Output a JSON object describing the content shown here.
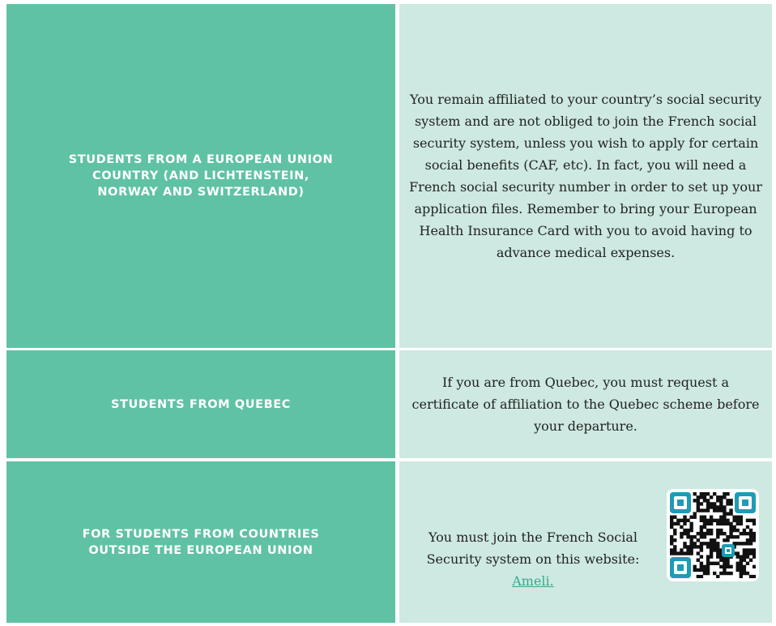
{
  "rows": [
    {
      "label": "STUDENTS FROM A EUROPEAN UNION COUNTRY (AND LICHTENSTEIN, NORWAY AND SWITZERLAND)",
      "text": "You remain affiliated to your country’s social security system and are not obliged to join the French social security system, unless you wish to apply for certain social benefits (CAF, etc). In fact, you will need a French social security number in order to set up your application files. Remember to bring your European Health Insurance Card with you to avoid having to advance medical expenses."
    },
    {
      "label": "STUDENTS FROM QUEBEC",
      "text": "If you are from Quebec, you must request a certificate of affiliation to the Quebec scheme before your departure."
    },
    {
      "label": "FOR STUDENTS FROM COUNTRIES OUTSIDE THE EUROPEAN UNION",
      "text": "You must join the French Social Security system on this website:",
      "link_label": "Ameli.",
      "qr_icon": "qr-code-icon"
    }
  ],
  "colors": {
    "left_bg": "#5fc2a4",
    "right_bg": "#cde9e1",
    "qr_accent": "#1e9bb5",
    "link": "#3aa88c"
  }
}
